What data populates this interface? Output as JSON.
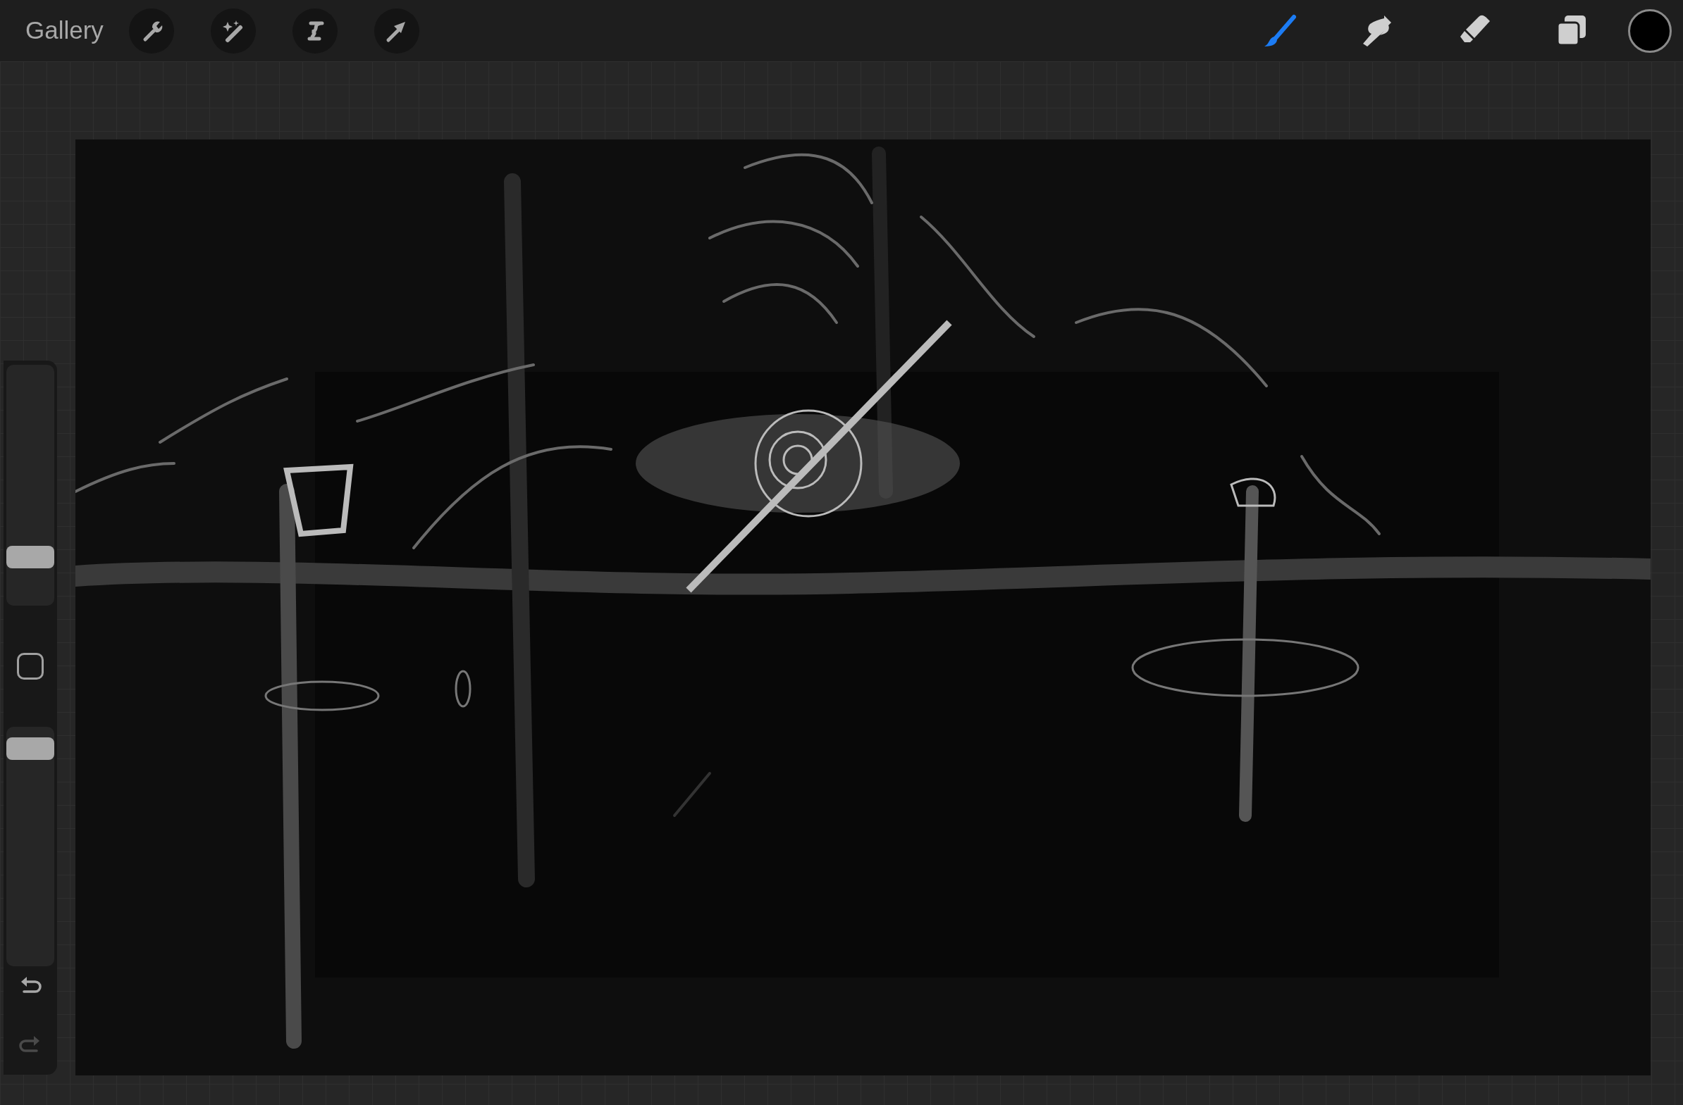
{
  "top_bar": {
    "gallery_label": "Gallery",
    "actions": [
      {
        "kind": "wrench"
      },
      {
        "kind": "wand"
      },
      {
        "kind": "selection"
      },
      {
        "kind": "transform"
      }
    ],
    "tools": [
      {
        "kind": "brush",
        "selected": true
      },
      {
        "kind": "smudge",
        "selected": false
      },
      {
        "kind": "eraser",
        "selected": false
      },
      {
        "kind": "layers",
        "selected": false
      }
    ],
    "color": "#000000"
  },
  "sidebar": {
    "size_slider": {
      "level": 0.17
    },
    "opacity_slider": {
      "level": 0.95
    },
    "undo": {
      "disabled": false
    },
    "redo": {
      "disabled": true
    }
  }
}
